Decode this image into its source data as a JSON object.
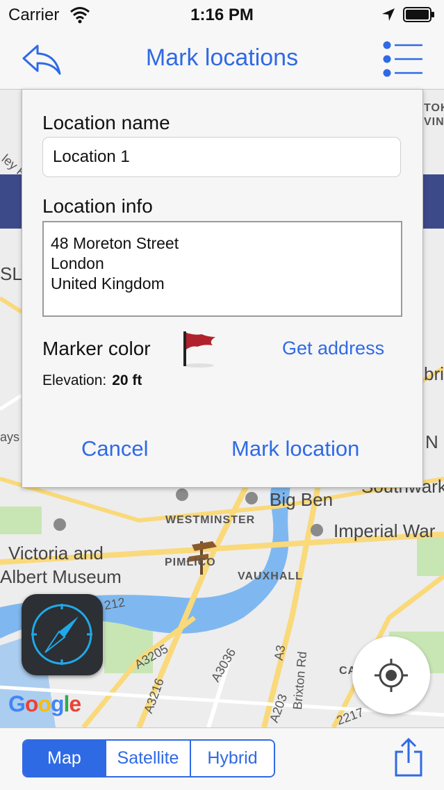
{
  "status_bar": {
    "carrier": "Carrier",
    "time": "1:16 PM"
  },
  "nav": {
    "title": "Mark locations"
  },
  "dialog": {
    "name_label": "Location name",
    "name_value": "Location 1",
    "info_label": "Location info",
    "info_lines": [
      "48 Moreton Street",
      "London",
      "United Kingdom"
    ],
    "marker_label": "Marker color",
    "get_address": "Get address",
    "elevation_label": "Elevation:",
    "elevation_value": "20 ft",
    "cancel": "Cancel",
    "mark_location": "Mark location"
  },
  "map": {
    "labels": {
      "big_ben": "Big Ben",
      "westminster": "WESTMINSTER",
      "imperial_war": "Imperial War",
      "victoria_albert_1": "Victoria and",
      "victoria_albert_2": "Albert Museum",
      "pimlico": "PIMLICO",
      "vauxhall": "VAUXHALL",
      "a3205": "A3205",
      "a3036": "A3036",
      "a3": "A3",
      "a3216": "A3216",
      "a203": "A203",
      "brixton_rd": "Brixton Rd",
      "a212": "212",
      "southwark": "Southwark",
      "ca": "CA",
      "tok": "TOK",
      "ving": "VING",
      "bric": "bric",
      "n": "N",
      "ays": "ays",
      "sl": "SL L",
      "ley": "ley R",
      "a2217": "2217"
    },
    "provider": "Google"
  },
  "toolbar": {
    "segments": [
      "Map",
      "Satellite",
      "Hybrid"
    ],
    "active_segment": "Map"
  },
  "colors": {
    "accent": "#2f6ae5",
    "flag": "#b0232c",
    "compass": "#1fa9e8",
    "water": "#7fb8f0",
    "park": "#c8e6b4",
    "road": "#f9d97a"
  }
}
